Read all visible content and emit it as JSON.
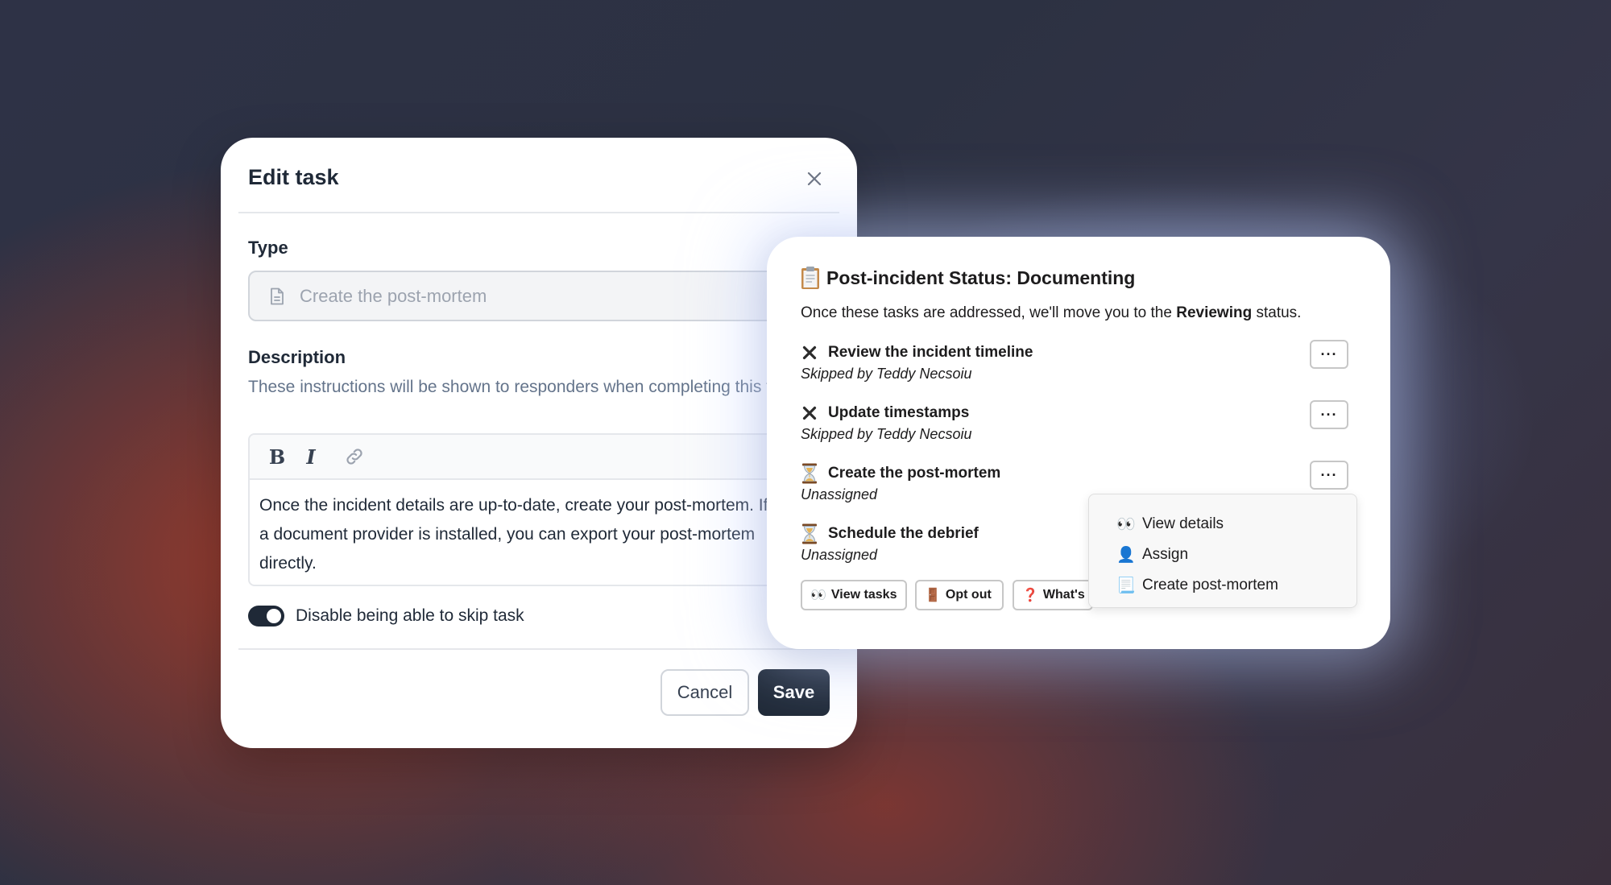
{
  "edit_task": {
    "title": "Edit task",
    "type_label": "Type",
    "type_value": "Create the post-mortem",
    "description_label": "Description",
    "description_help": "These instructions will be shown to responders when completing this task.",
    "editor_lines": [
      "Once the incident details are up-to-date, create your post-mortem. If",
      "a document provider is installed, you can export your post-mortem",
      "directly."
    ],
    "toggle_label": "Disable being able to skip task",
    "toggle_on": true,
    "cancel_label": "Cancel",
    "save_label": "Save"
  },
  "status_card": {
    "title": "Post-incident Status: Documenting",
    "intro_prefix": "Once these tasks are addressed, we'll move you to the ",
    "intro_bold": "Reviewing",
    "intro_suffix": " status.",
    "tasks": [
      {
        "title": "Review the incident timeline",
        "subtitle": "Skipped by Teddy Necsoiu",
        "icon": "x-icon"
      },
      {
        "title": "Update timestamps",
        "subtitle": "Skipped by Teddy Necsoiu",
        "icon": "x-icon"
      },
      {
        "title": "Create the post-mortem",
        "subtitle": "Unassigned",
        "icon": "hourglass-icon"
      },
      {
        "title": "Schedule the debrief",
        "subtitle": "Unassigned",
        "icon": "hourglass-icon"
      }
    ],
    "more_label": "···",
    "actions": [
      {
        "emoji": "👀",
        "label": "View tasks"
      },
      {
        "emoji": "🚪",
        "label": "Opt out"
      },
      {
        "emoji": "❓",
        "label": "What's"
      }
    ],
    "menu_items": [
      {
        "emoji": "👀",
        "label": "View details"
      },
      {
        "emoji": "👤",
        "label": "Assign"
      },
      {
        "emoji": "📃",
        "label": "Create post-mortem"
      }
    ]
  }
}
